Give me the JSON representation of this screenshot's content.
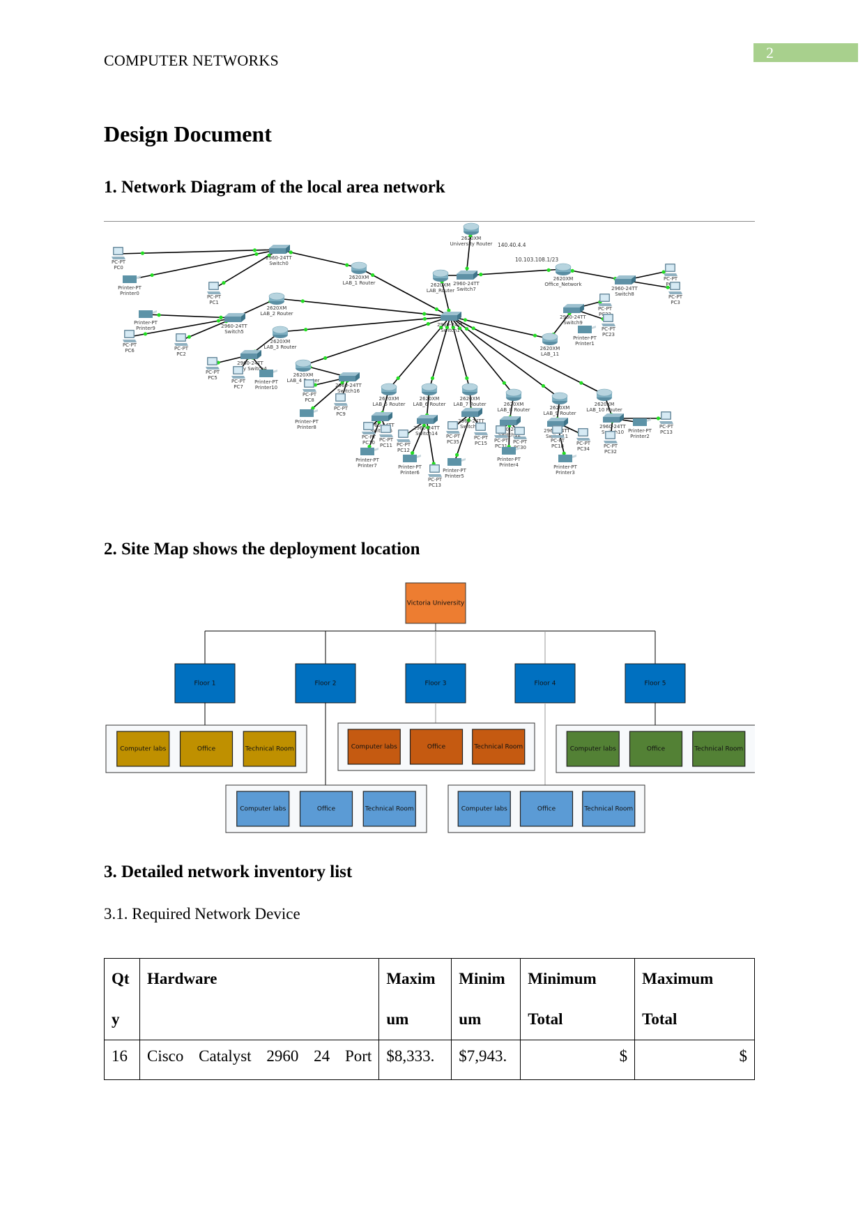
{
  "header": {
    "title": "COMPUTER NETWORKS",
    "page_number": "2",
    "badge_color": "#a8d08d"
  },
  "document": {
    "title": "Design Document"
  },
  "sections": {
    "s1": {
      "heading": "1. Network Diagram of the local area network"
    },
    "s2": {
      "heading": "2. Site Map shows the deployment location"
    },
    "s3": {
      "heading": "3. Detailed network inventory list",
      "subheading": "3.1. Required Network Device"
    }
  },
  "network_diagram": {
    "annotations": [
      "140.40.4.4",
      "10.103.108.1/23"
    ],
    "link_color": "#000000",
    "port_color": "#22dd22",
    "devices": [
      {
        "id": "PC0",
        "type": "pc",
        "model": "PC-PT",
        "name": "PC0"
      },
      {
        "id": "Printer0",
        "type": "printer",
        "model": "Printer-PT",
        "name": "Printer0"
      },
      {
        "id": "Switch0",
        "type": "switch",
        "model": "2960-24TT",
        "name": "Switch0"
      },
      {
        "id": "PC1",
        "type": "pc",
        "model": "PC-PT",
        "name": "PC1"
      },
      {
        "id": "LAB1",
        "type": "router",
        "model": "2620XM",
        "name": "LAB_1 Router"
      },
      {
        "id": "LAB2",
        "type": "router",
        "model": "2620XM",
        "name": "LAB_2 Router"
      },
      {
        "id": "Printer9",
        "type": "printer",
        "model": "Printer-PT",
        "name": "Printer9"
      },
      {
        "id": "Switch5",
        "type": "switch",
        "model": "2960-24TT",
        "name": "Switch5"
      },
      {
        "id": "PC6",
        "type": "pc",
        "model": "PC-PT",
        "name": "PC6"
      },
      {
        "id": "PC2",
        "type": "pc",
        "model": "PC-PT",
        "name": "PC2"
      },
      {
        "id": "LAB3",
        "type": "router",
        "model": "2620XM",
        "name": "LAB_3 Router"
      },
      {
        "id": "Switch4",
        "type": "switch",
        "model": "2960-24TT",
        "name": "Copy Switch4"
      },
      {
        "id": "PC5",
        "type": "pc",
        "model": "PC-PT",
        "name": "PC5"
      },
      {
        "id": "PC7",
        "type": "pc",
        "model": "PC-PT",
        "name": "PC7"
      },
      {
        "id": "Printer10",
        "type": "printer",
        "model": "Printer-PT",
        "name": "Printer10"
      },
      {
        "id": "LAB4",
        "type": "router",
        "model": "2620XM",
        "name": "LAB_4 Router"
      },
      {
        "id": "Switch16",
        "type": "switch",
        "model": "2960-24TT",
        "name": "Switch16"
      },
      {
        "id": "PC8",
        "type": "pc",
        "model": "PC-PT",
        "name": "PC8"
      },
      {
        "id": "PC9",
        "type": "pc",
        "model": "PC-PT",
        "name": "PC9"
      },
      {
        "id": "Printer8",
        "type": "printer",
        "model": "Printer-PT",
        "name": "Printer8"
      },
      {
        "id": "UniRouter",
        "type": "router",
        "model": "2620XM",
        "name": "University Router"
      },
      {
        "id": "Switch7",
        "type": "switch",
        "model": "2960-24TT",
        "name": "Switch7"
      },
      {
        "id": "LABRouter",
        "type": "router",
        "model": "2620XM",
        "name": "LAB_Router"
      },
      {
        "id": "Switch1",
        "type": "switch",
        "model": "2960-24TT",
        "name": "Switch1"
      },
      {
        "id": "Office",
        "type": "router",
        "model": "2620XM",
        "name": "Office_Network"
      },
      {
        "id": "Switch8",
        "type": "switch",
        "model": "2960-24TT",
        "name": "Switch8"
      },
      {
        "id": "PC4",
        "type": "pc",
        "model": "PC-PT",
        "name": "PC4"
      },
      {
        "id": "PC3",
        "type": "pc",
        "model": "PC-PT",
        "name": "PC3"
      },
      {
        "id": "Switch9",
        "type": "switch",
        "model": "2960-24TT",
        "name": "Switch9"
      },
      {
        "id": "PC22",
        "type": "pc",
        "model": "PC-PT",
        "name": "PC22"
      },
      {
        "id": "PC23",
        "type": "pc",
        "model": "PC-PT",
        "name": "PC23"
      },
      {
        "id": "Printer1",
        "type": "printer",
        "model": "Printer-PT",
        "name": "Printer1"
      },
      {
        "id": "LAB11",
        "type": "router",
        "model": "2620XM",
        "name": "LAB_11"
      },
      {
        "id": "LAB5",
        "type": "router",
        "model": "2620XM",
        "name": "LAB_5 Router"
      },
      {
        "id": "Switch15",
        "type": "switch",
        "model": "2960-24TT",
        "name": "Switch15"
      },
      {
        "id": "PC10",
        "type": "pc",
        "model": "PC-PT",
        "name": "PC10"
      },
      {
        "id": "PC11",
        "type": "pc",
        "model": "PC-PT",
        "name": "PC11"
      },
      {
        "id": "Printer7",
        "type": "printer",
        "model": "Printer-PT",
        "name": "Printer7"
      },
      {
        "id": "LAB6",
        "type": "router",
        "model": "2620XM",
        "name": "LAB_6 Router"
      },
      {
        "id": "Switch14",
        "type": "switch",
        "model": "2960-24TT",
        "name": "Switch14"
      },
      {
        "id": "PC12",
        "type": "pc",
        "model": "PC-PT",
        "name": "PC12"
      },
      {
        "id": "Printer6",
        "type": "printer",
        "model": "Printer-PT",
        "name": "Printer6"
      },
      {
        "id": "PC13b",
        "type": "pc",
        "model": "PC-PT",
        "name": "PC13"
      },
      {
        "id": "LAB7",
        "type": "router",
        "model": "2620XM",
        "name": "LAB_7 Router"
      },
      {
        "id": "Switch13",
        "type": "switch",
        "model": "2960-24TT",
        "name": "Switch13"
      },
      {
        "id": "PC35",
        "type": "pc",
        "model": "PC-PT",
        "name": "PC35"
      },
      {
        "id": "PC15",
        "type": "pc",
        "model": "PC-PT",
        "name": "PC15"
      },
      {
        "id": "Printer5",
        "type": "printer",
        "model": "Printer-PT",
        "name": "Printer5"
      },
      {
        "id": "LAB8",
        "type": "router",
        "model": "2620XM",
        "name": "LAB_8 Router"
      },
      {
        "id": "Switch12",
        "type": "switch",
        "model": "2960-24TT",
        "name": "Switch12"
      },
      {
        "id": "PC31",
        "type": "pc",
        "model": "PC-PT",
        "name": "PC31"
      },
      {
        "id": "PC30",
        "type": "pc",
        "model": "PC-PT",
        "name": "PC30"
      },
      {
        "id": "Printer4",
        "type": "printer",
        "model": "Printer-PT",
        "name": "Printer4"
      },
      {
        "id": "LAB9",
        "type": "router",
        "model": "2620XM",
        "name": "LAB_9 Router"
      },
      {
        "id": "Switch11",
        "type": "switch",
        "model": "2960-24TT",
        "name": "Switch11"
      },
      {
        "id": "PC18",
        "type": "pc",
        "model": "PC-PT",
        "name": "PC18"
      },
      {
        "id": "PC34",
        "type": "pc",
        "model": "PC-PT",
        "name": "PC34"
      },
      {
        "id": "Printer3",
        "type": "printer",
        "model": "Printer-PT",
        "name": "Printer3"
      },
      {
        "id": "LAB10",
        "type": "router",
        "model": "2620XM",
        "name": "LAB_10 Router"
      },
      {
        "id": "Switch10",
        "type": "switch",
        "model": "2960-24TT",
        "name": "Switch10"
      },
      {
        "id": "PC32",
        "type": "pc",
        "model": "PC-PT",
        "name": "PC32"
      },
      {
        "id": "Printer2",
        "type": "printer",
        "model": "Printer-PT",
        "name": "Printer2"
      },
      {
        "id": "PC13",
        "type": "pc",
        "model": "PC-PT",
        "name": "PC13"
      }
    ],
    "links": [
      [
        "PC0",
        "Switch0"
      ],
      [
        "Printer0",
        "Switch0"
      ],
      [
        "PC1",
        "Switch0"
      ],
      [
        "Switch0",
        "LAB1"
      ],
      [
        "LAB1",
        "Switch1"
      ],
      [
        "LAB2",
        "Switch1"
      ],
      [
        "LAB2",
        "Switch5"
      ],
      [
        "Printer9",
        "Switch5"
      ],
      [
        "PC6",
        "Switch5"
      ],
      [
        "PC2",
        "Switch5"
      ],
      [
        "LAB3",
        "Switch1"
      ],
      [
        "LAB3",
        "Switch4"
      ],
      [
        "PC5",
        "Switch4"
      ],
      [
        "PC7",
        "Switch4"
      ],
      [
        "Printer10",
        "Switch4"
      ],
      [
        "LAB4",
        "Switch1"
      ],
      [
        "LAB4",
        "Switch16"
      ],
      [
        "PC8",
        "Switch16"
      ],
      [
        "PC9",
        "Switch16"
      ],
      [
        "Printer8",
        "Switch16"
      ],
      [
        "UniRouter",
        "Switch7"
      ],
      [
        "LABRouter",
        "Switch7"
      ],
      [
        "Switch7",
        "Office"
      ],
      [
        "LABRouter",
        "Switch1"
      ],
      [
        "Office",
        "Switch8"
      ],
      [
        "Switch8",
        "PC4"
      ],
      [
        "Switch8",
        "PC3"
      ],
      [
        "LAB11",
        "Switch1"
      ],
      [
        "LAB11",
        "Switch9"
      ],
      [
        "Switch9",
        "PC22"
      ],
      [
        "Switch9",
        "PC23"
      ],
      [
        "LAB5",
        "Switch1"
      ],
      [
        "LAB5",
        "Switch15"
      ],
      [
        "Switch15",
        "PC10"
      ],
      [
        "Switch15",
        "PC11"
      ],
      [
        "Switch15",
        "Printer7"
      ],
      [
        "LAB6",
        "Switch1"
      ],
      [
        "LAB6",
        "Switch14"
      ],
      [
        "Switch14",
        "PC12"
      ],
      [
        "Switch14",
        "Printer6"
      ],
      [
        "Switch14",
        "PC13b"
      ],
      [
        "LAB7",
        "Switch1"
      ],
      [
        "LAB7",
        "Switch13"
      ],
      [
        "Switch13",
        "PC35"
      ],
      [
        "Switch13",
        "PC15"
      ],
      [
        "Switch13",
        "Printer5"
      ],
      [
        "LAB8",
        "Switch1"
      ],
      [
        "LAB8",
        "Switch12"
      ],
      [
        "Switch12",
        "PC31"
      ],
      [
        "Switch12",
        "PC30"
      ],
      [
        "Switch12",
        "Printer4"
      ],
      [
        "LAB9",
        "Switch1"
      ],
      [
        "LAB9",
        "Switch11"
      ],
      [
        "Switch11",
        "PC18"
      ],
      [
        "Switch11",
        "PC34"
      ],
      [
        "Switch11",
        "Printer3"
      ],
      [
        "LAB10",
        "Switch1"
      ],
      [
        "LAB10",
        "Switch10"
      ],
      [
        "Switch10",
        "PC32"
      ],
      [
        "Switch10",
        "Printer2"
      ],
      [
        "Switch10",
        "PC13"
      ]
    ]
  },
  "site_map": {
    "root": {
      "label": "Victoria University",
      "color": "#ed7d31"
    },
    "floor_color": "#0070c0",
    "floors": [
      {
        "label": "Floor 1",
        "room_color": "#bf9000",
        "rooms": [
          "Computer labs",
          "Office",
          "Technical Room"
        ]
      },
      {
        "label": "Floor 2",
        "room_color": "#5b9bd5",
        "rooms": [
          "Computer labs",
          "Office",
          "Technical Room"
        ]
      },
      {
        "label": "Floor 3",
        "room_color": "#c55a11",
        "rooms": [
          "Computer labs",
          "Office",
          "Technical Room"
        ]
      },
      {
        "label": "Floor 4",
        "room_color": "#5b9bd5",
        "rooms": [
          "Computer labs",
          "Office",
          "Technical Room"
        ]
      },
      {
        "label": "Floor 5",
        "room_color": "#538135",
        "rooms": [
          "Computer labs",
          "Office",
          "Technical Room"
        ]
      }
    ]
  },
  "inventory_table": {
    "headers": [
      "Qt y",
      "Hardware",
      "Maxim um",
      "Minim um",
      "Minimum Total",
      "Maximum Total"
    ],
    "headers_lines": [
      [
        "Qt",
        "y"
      ],
      [
        "Hardware",
        ""
      ],
      [
        "Maxim",
        "um"
      ],
      [
        "Minim",
        "um"
      ],
      [
        "Minimum",
        "Total"
      ],
      [
        "Maximum",
        "Total"
      ]
    ],
    "rows": [
      {
        "qty": "16",
        "hardware": "Cisco Catalyst 2960 24 Port",
        "maximum": "$8,333.",
        "minimum": "$7,943.",
        "minimum_total": "$",
        "maximum_total": "$"
      }
    ]
  }
}
